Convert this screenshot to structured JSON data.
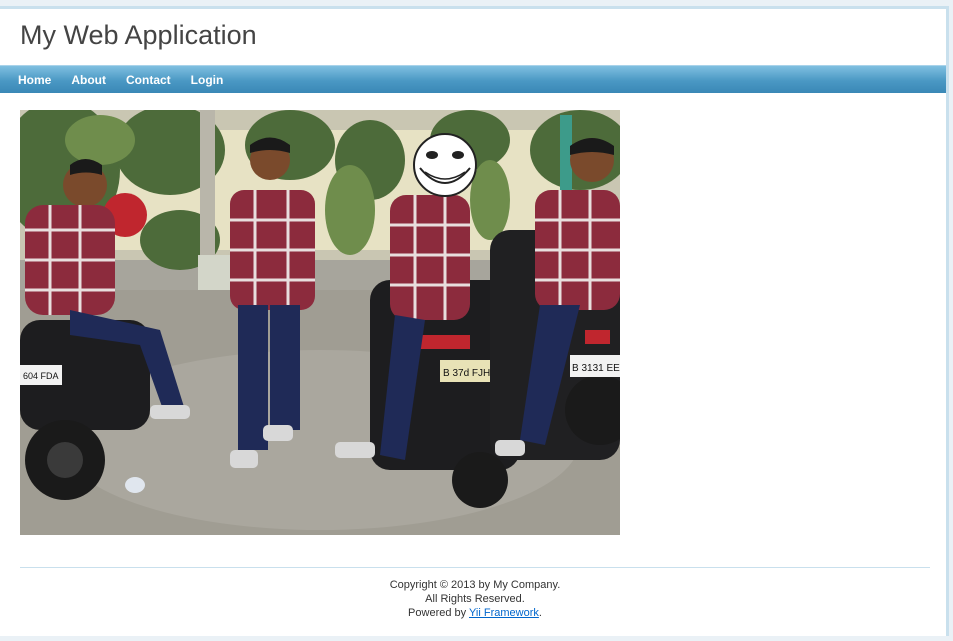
{
  "header": {
    "title": "My Web Application"
  },
  "menu": {
    "items": [
      {
        "label": "Home"
      },
      {
        "label": "About"
      },
      {
        "label": "Contact"
      },
      {
        "label": "Login"
      }
    ]
  },
  "content": {
    "image_plates": {
      "left": "604 FDA",
      "center": "B 37d FJH",
      "right": "B 3131 EE"
    }
  },
  "footer": {
    "copyright": "Copyright © 2013 by My Company.",
    "rights": "All Rights Reserved.",
    "powered_prefix": "Powered by ",
    "powered_link": "Yii Framework",
    "powered_suffix": "."
  },
  "colors": {
    "menu_bar": "#4a98c4",
    "link": "#0066cc",
    "border": "#c9e0ed"
  }
}
